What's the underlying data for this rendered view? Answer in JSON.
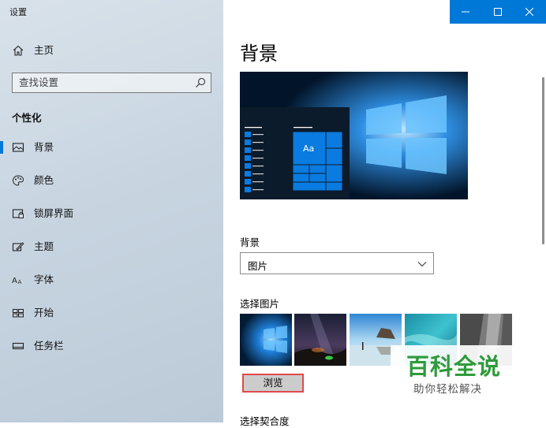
{
  "window": {
    "title": "设置"
  },
  "caption_buttons": {
    "minimize": "minimize-icon",
    "maximize": "maximize-icon",
    "close": "close-icon",
    "accent": "#0078d7"
  },
  "sidebar": {
    "home": {
      "label": "主页",
      "icon": "home-icon"
    },
    "search": {
      "placeholder": "查找设置",
      "icon": "search-icon"
    },
    "section": "个性化",
    "items": [
      {
        "label": "背景",
        "icon": "picture-icon",
        "selected": true
      },
      {
        "label": "颜色",
        "icon": "palette-icon",
        "selected": false
      },
      {
        "label": "锁屏界面",
        "icon": "lock-screen-icon",
        "selected": false
      },
      {
        "label": "主题",
        "icon": "theme-icon",
        "selected": false
      },
      {
        "label": "字体",
        "icon": "font-icon",
        "selected": false
      },
      {
        "label": "开始",
        "icon": "start-icon",
        "selected": false
      },
      {
        "label": "任务栏",
        "icon": "taskbar-icon",
        "selected": false
      }
    ]
  },
  "main": {
    "title": "背景",
    "preview": {
      "sample_text": "Aa"
    },
    "background": {
      "label": "背景",
      "value": "图片"
    },
    "choose_picture": {
      "label": "选择图片",
      "thumbnails": [
        "windows-hero",
        "night-sky",
        "beach-rocks",
        "underwater",
        "rock-cliff"
      ]
    },
    "browse_label": "浏览",
    "fit_label": "选择契合度"
  },
  "watermark": {
    "main": "百科全说",
    "sub": "助你轻松解决"
  }
}
